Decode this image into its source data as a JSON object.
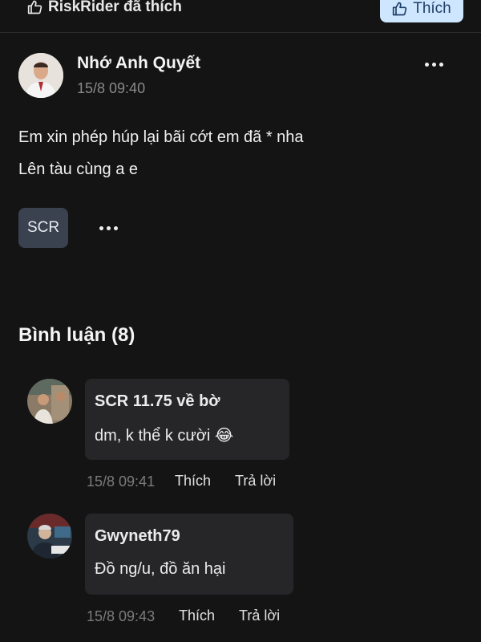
{
  "top": {
    "liker_text": "RiskRider đã thích",
    "like_button": "Thích"
  },
  "post": {
    "author": "Nhớ Anh Quyết",
    "time": "15/8 09:40",
    "lines": [
      "Em xin phép húp lại bãi cớt em đã * nha",
      "Lên tàu cùng a e"
    ],
    "tag": "SCR"
  },
  "comments_header": "Bình luận (8)",
  "comments": [
    {
      "name": "SCR 11.75 về bờ",
      "text": "dm, k thể k cười 😂",
      "time": "15/8 09:41",
      "like": "Thích",
      "reply": "Trả lời"
    },
    {
      "name": "Gwyneth79",
      "text": "Đồ ng/u, đồ ăn hại",
      "time": "15/8 09:43",
      "like": "Thích",
      "reply": "Trả lời"
    }
  ],
  "icons": [
    "thumbs-up-icon",
    "more-icon"
  ],
  "colors": {
    "background": "#141414",
    "like_button_bg": "#cfe6ff",
    "tag_bg": "#3a4250",
    "bubble_bg": "#262628"
  }
}
